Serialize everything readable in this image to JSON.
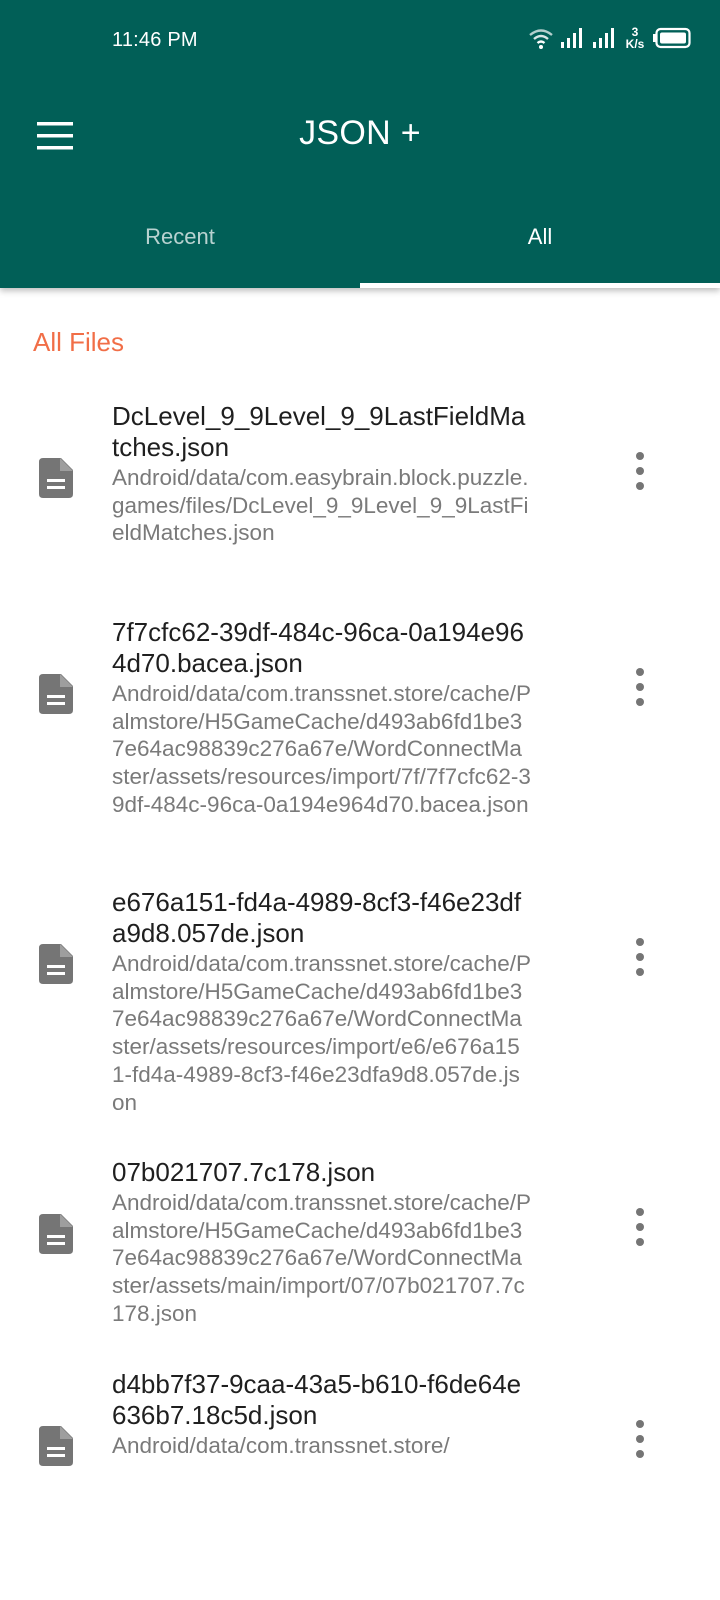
{
  "status": {
    "time": "11:46 PM",
    "net_speed_value": "3",
    "net_speed_unit": "K/s",
    "icons": [
      "wifi-icon",
      "signal-icon",
      "signal-icon",
      "battery-icon"
    ]
  },
  "toolbar": {
    "title": "JSON +",
    "menu_icon": "hamburger-menu-icon"
  },
  "tabs": [
    {
      "label": "Recent",
      "selected": false
    },
    {
      "label": "All",
      "selected": true
    }
  ],
  "section": {
    "title": "All Files"
  },
  "colors": {
    "primary": "#015f57",
    "accent": "#f16e47",
    "title_text": "#1f1f1f",
    "path_text": "#7a7a7a"
  },
  "files": [
    {
      "name": "DcLevel_9_9Level_9_9LastFieldMatches.json",
      "path": "Android/data/com.easybrain.block.puzzle.games/files/DcLevel_9_9Level_9_9LastFieldMatches.json"
    },
    {
      "name": "7f7cfc62-39df-484c-96ca-0a194e964d70.bacea.json",
      "path": "Android/data/com.transsnet.store/cache/Palmstore/H5GameCache/d493ab6fd1be37e64ac98839c276a67e/WordConnectMaster/assets/resources/import/7f/7f7cfc62-39df-484c-96ca-0a194e964d70.bacea.json"
    },
    {
      "name": "e676a151-fd4a-4989-8cf3-f46e23dfa9d8.057de.json",
      "path": "Android/data/com.transsnet.store/cache/Palmstore/H5GameCache/d493ab6fd1be37e64ac98839c276a67e/WordConnectMaster/assets/resources/import/e6/e676a151-fd4a-4989-8cf3-f46e23dfa9d8.057de.json"
    },
    {
      "name": "07b021707.7c178.json",
      "path": "Android/data/com.transsnet.store/cache/Palmstore/H5GameCache/d493ab6fd1be37e64ac98839c276a67e/WordConnectMaster/assets/main/import/07/07b021707.7c178.json"
    },
    {
      "name": "d4bb7f37-9caa-43a5-b610-f6de64e636b7.18c5d.json",
      "path": "Android/data/com.transsnet.store/"
    }
  ]
}
